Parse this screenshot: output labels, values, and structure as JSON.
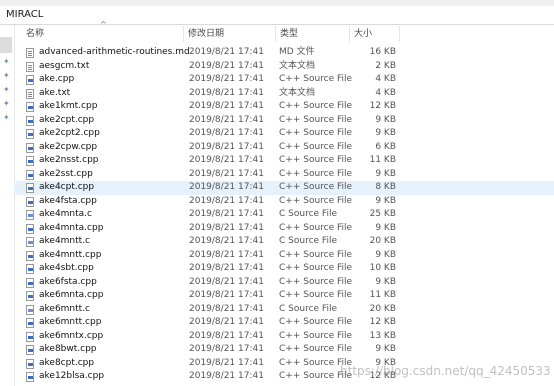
{
  "path_label": "MIRACL",
  "columns": {
    "name": "名称",
    "date": "修改日期",
    "type": "类型",
    "size": "大小"
  },
  "sort_arrow": "^",
  "files": [
    {
      "name": "advanced-arithmetic-routines.md",
      "date": "2019/8/21 17:41",
      "type": "MD 文件",
      "size": "16 KB",
      "icon": "txt"
    },
    {
      "name": "aesgcm.txt",
      "date": "2019/8/21 17:41",
      "type": "文本文档",
      "size": "2 KB",
      "icon": "txt"
    },
    {
      "name": "ake.cpp",
      "date": "2019/8/21 17:41",
      "type": "C++ Source File",
      "size": "4 KB",
      "icon": "cpp"
    },
    {
      "name": "ake.txt",
      "date": "2019/8/21 17:41",
      "type": "文本文档",
      "size": "4 KB",
      "icon": "txt"
    },
    {
      "name": "ake1kmt.cpp",
      "date": "2019/8/21 17:41",
      "type": "C++ Source File",
      "size": "12 KB",
      "icon": "cpp"
    },
    {
      "name": "ake2cpt.cpp",
      "date": "2019/8/21 17:41",
      "type": "C++ Source File",
      "size": "9 KB",
      "icon": "cpp"
    },
    {
      "name": "ake2cpt2.cpp",
      "date": "2019/8/21 17:41",
      "type": "C++ Source File",
      "size": "9 KB",
      "icon": "cpp"
    },
    {
      "name": "ake2cpw.cpp",
      "date": "2019/8/21 17:41",
      "type": "C++ Source File",
      "size": "6 KB",
      "icon": "cpp"
    },
    {
      "name": "ake2nsst.cpp",
      "date": "2019/8/21 17:41",
      "type": "C++ Source File",
      "size": "11 KB",
      "icon": "cpp"
    },
    {
      "name": "ake2sst.cpp",
      "date": "2019/8/21 17:41",
      "type": "C++ Source File",
      "size": "9 KB",
      "icon": "cpp"
    },
    {
      "name": "ake4cpt.cpp",
      "date": "2019/8/21 17:41",
      "type": "C++ Source File",
      "size": "8 KB",
      "icon": "cpp",
      "selected": true
    },
    {
      "name": "ake4fsta.cpp",
      "date": "2019/8/21 17:41",
      "type": "C++ Source File",
      "size": "9 KB",
      "icon": "cpp"
    },
    {
      "name": "ake4mnta.c",
      "date": "2019/8/21 17:41",
      "type": "C Source File",
      "size": "25 KB",
      "icon": "c"
    },
    {
      "name": "ake4mnta.cpp",
      "date": "2019/8/21 17:41",
      "type": "C++ Source File",
      "size": "9 KB",
      "icon": "cpp"
    },
    {
      "name": "ake4mntt.c",
      "date": "2019/8/21 17:41",
      "type": "C Source File",
      "size": "20 KB",
      "icon": "c"
    },
    {
      "name": "ake4mntt.cpp",
      "date": "2019/8/21 17:41",
      "type": "C++ Source File",
      "size": "9 KB",
      "icon": "cpp"
    },
    {
      "name": "ake4sbt.cpp",
      "date": "2019/8/21 17:41",
      "type": "C++ Source File",
      "size": "10 KB",
      "icon": "cpp"
    },
    {
      "name": "ake6fsta.cpp",
      "date": "2019/8/21 17:41",
      "type": "C++ Source File",
      "size": "9 KB",
      "icon": "cpp"
    },
    {
      "name": "ake6mnta.cpp",
      "date": "2019/8/21 17:41",
      "type": "C++ Source File",
      "size": "11 KB",
      "icon": "cpp"
    },
    {
      "name": "ake6mntt.c",
      "date": "2019/8/21 17:41",
      "type": "C Source File",
      "size": "20 KB",
      "icon": "c"
    },
    {
      "name": "ake6mntt.cpp",
      "date": "2019/8/21 17:41",
      "type": "C++ Source File",
      "size": "12 KB",
      "icon": "cpp"
    },
    {
      "name": "ake6mntx.cpp",
      "date": "2019/8/21 17:41",
      "type": "C++ Source File",
      "size": "13 KB",
      "icon": "cpp"
    },
    {
      "name": "ake8bwt.cpp",
      "date": "2019/8/21 17:41",
      "type": "C++ Source File",
      "size": "9 KB",
      "icon": "cpp"
    },
    {
      "name": "ake8cpt.cpp",
      "date": "2019/8/21 17:41",
      "type": "C++ Source File",
      "size": "9 KB",
      "icon": "cpp"
    },
    {
      "name": "ake12blsa.cpp",
      "date": "2019/8/21 17:41",
      "type": "C++ Source File",
      "size": "12 KB",
      "icon": "cpp"
    }
  ],
  "watermark": "https://blog.csdn.net/qq_42450533"
}
